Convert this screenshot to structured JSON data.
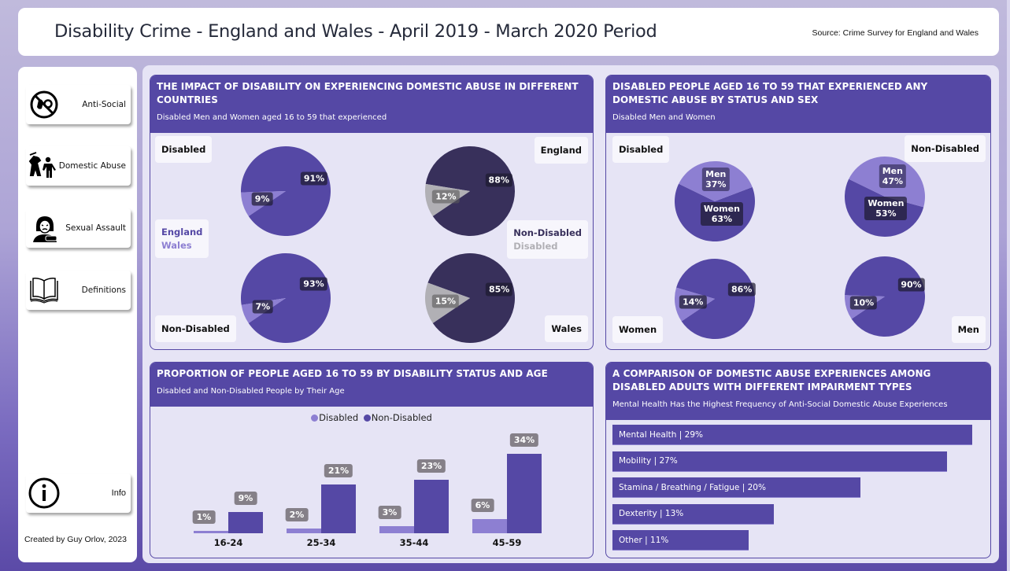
{
  "header": {
    "title": "Disability Crime - England and Wales - April 2019 - March 2020 Period",
    "source": "Source: Crime Survey for England and Wales"
  },
  "sidebar": {
    "items": [
      {
        "label": "Anti-Social",
        "icon": "no-noise-icon"
      },
      {
        "label": "Domestic Abuse",
        "icon": "domestic-violence-icon"
      },
      {
        "label": "Sexual Assault",
        "icon": "sexual-assault-icon"
      },
      {
        "label": "Definitions",
        "icon": "open-book-icon"
      },
      {
        "label": "Info",
        "icon": "info-icon"
      }
    ],
    "credit": "Created by Guy Orlov, 2023"
  },
  "colors": {
    "primary": "#5548a5",
    "light_purple": "#8d7fd2",
    "dark_navy": "#38305b",
    "grey": "#b1b0b5",
    "panel_bg": "#e6e4f5"
  },
  "panels": {
    "countries": {
      "title": "THE IMPACT OF DISABILITY ON EXPERIENCING DOMESTIC ABUSE IN DIFFERENT COUNTRIES",
      "subtitle": "Disabled Men and Women aged 16 to 59 that experienced",
      "tags": {
        "disabled": "Disabled",
        "england": "England",
        "non_disabled": "Non-Disabled",
        "wales": "Wales"
      },
      "legend_left": [
        "England",
        "Wales"
      ],
      "legend_right": [
        "Non-Disabled",
        "Disabled"
      ]
    },
    "status_sex": {
      "title": "DISABLED PEOPLE AGED 16 TO 59 THAT EXPERIENCED ANY DOMESTIC ABUSE BY STATUS AND SEX",
      "subtitle": "Disabled Men and Women",
      "tags": {
        "disabled": "Disabled",
        "non_disabled": "Non-Disabled",
        "women": "Women",
        "men": "Men"
      }
    },
    "age": {
      "title": "PROPORTION OF PEOPLE AGED 16 TO 59 BY DISABILITY STATUS AND AGE",
      "subtitle": "Disabled and Non-Disabled People by Their Age"
    },
    "impairment": {
      "title": "A COMPARISON OF DOMESTIC ABUSE EXPERIENCES AMONG DISABLED ADULTS WITH DIFFERENT IMPAIRMENT TYPES",
      "subtitle": "Mental Health Has the Highest Frequency of Anti-Social Domestic Abuse Experiences"
    }
  },
  "chart_data": [
    {
      "type": "pie",
      "title": "Disabled",
      "id": "pie-disabled-country",
      "slices": [
        {
          "name": "England",
          "value": 91,
          "label": "91%"
        },
        {
          "name": "Wales",
          "value": 9,
          "label": "9%"
        }
      ]
    },
    {
      "type": "pie",
      "title": "Non-Disabled",
      "id": "pie-nondisabled-country",
      "slices": [
        {
          "name": "England",
          "value": 93,
          "label": "93%"
        },
        {
          "name": "Wales",
          "value": 7,
          "label": "7%"
        }
      ]
    },
    {
      "type": "pie",
      "title": "England",
      "id": "pie-england",
      "slices": [
        {
          "name": "Non-Disabled",
          "value": 88,
          "label": "88%"
        },
        {
          "name": "Disabled",
          "value": 12,
          "label": "12%"
        }
      ]
    },
    {
      "type": "pie",
      "title": "Wales",
      "id": "pie-wales",
      "slices": [
        {
          "name": "Non-Disabled",
          "value": 85,
          "label": "85%"
        },
        {
          "name": "Disabled",
          "value": 15,
          "label": "15%"
        }
      ]
    },
    {
      "type": "pie",
      "title": "Disabled",
      "id": "pie-disabled-sex",
      "slices": [
        {
          "name": "Women",
          "value": 63,
          "label": "Women\n63%"
        },
        {
          "name": "Men",
          "value": 37,
          "label": "Men\n37%"
        }
      ]
    },
    {
      "type": "pie",
      "title": "Non-Disabled",
      "id": "pie-nondisabled-sex",
      "slices": [
        {
          "name": "Women",
          "value": 53,
          "label": "Women\n53%"
        },
        {
          "name": "Men",
          "value": 47,
          "label": "Men\n47%"
        }
      ]
    },
    {
      "type": "pie",
      "title": "Women",
      "id": "pie-women",
      "slices": [
        {
          "name": "Non-Disabled",
          "value": 86,
          "label": "86%"
        },
        {
          "name": "Disabled",
          "value": 14,
          "label": "14%"
        }
      ]
    },
    {
      "type": "pie",
      "title": "Men",
      "id": "pie-men",
      "slices": [
        {
          "name": "Non-Disabled",
          "value": 90,
          "label": "90%"
        },
        {
          "name": "Disabled",
          "value": 10,
          "label": "10%"
        }
      ]
    },
    {
      "type": "bar",
      "id": "bar-age",
      "title": "PROPORTION OF PEOPLE AGED 16 TO 59 BY DISABILITY STATUS AND AGE",
      "categories": [
        "16-24",
        "25-34",
        "35-44",
        "45-59"
      ],
      "series": [
        {
          "name": "Disabled",
          "values": [
            1,
            2,
            3,
            6
          ]
        },
        {
          "name": "Non-Disabled",
          "values": [
            9,
            21,
            23,
            34
          ]
        }
      ],
      "ylim": [
        0,
        34
      ],
      "legend": "top-center",
      "data_label_suffix": "%"
    },
    {
      "type": "bar",
      "orientation": "horizontal",
      "id": "bar-impairment",
      "title": "A COMPARISON OF DOMESTIC ABUSE EXPERIENCES AMONG DISABLED ADULTS WITH DIFFERENT IMPAIRMENT TYPES",
      "categories": [
        "Mental Health",
        "Mobility",
        "Stamina / Breathing / Fatigue",
        "Dexterity",
        "Other"
      ],
      "values": [
        29,
        27,
        20,
        13,
        11
      ],
      "labels": [
        "Mental Health | 29%",
        "Mobility | 27%",
        "Stamina / Breathing / Fatigue | 20%",
        "Dexterity | 13%",
        "Other | 11%"
      ],
      "xlim": [
        0,
        29
      ]
    }
  ]
}
